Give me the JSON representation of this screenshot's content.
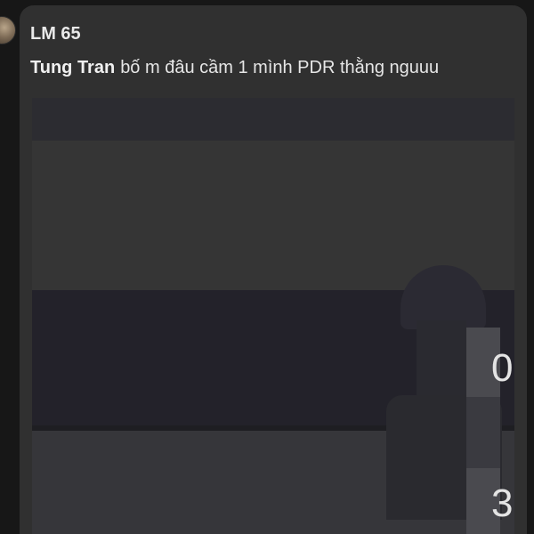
{
  "chat": {
    "group_name": "LM 65",
    "message": {
      "sender": "Tung Tran",
      "text": "bố m đâu cầm 1 mình PDR thằng nguuu"
    }
  },
  "media_preview": {
    "glyphs": [
      "0",
      "3"
    ]
  }
}
